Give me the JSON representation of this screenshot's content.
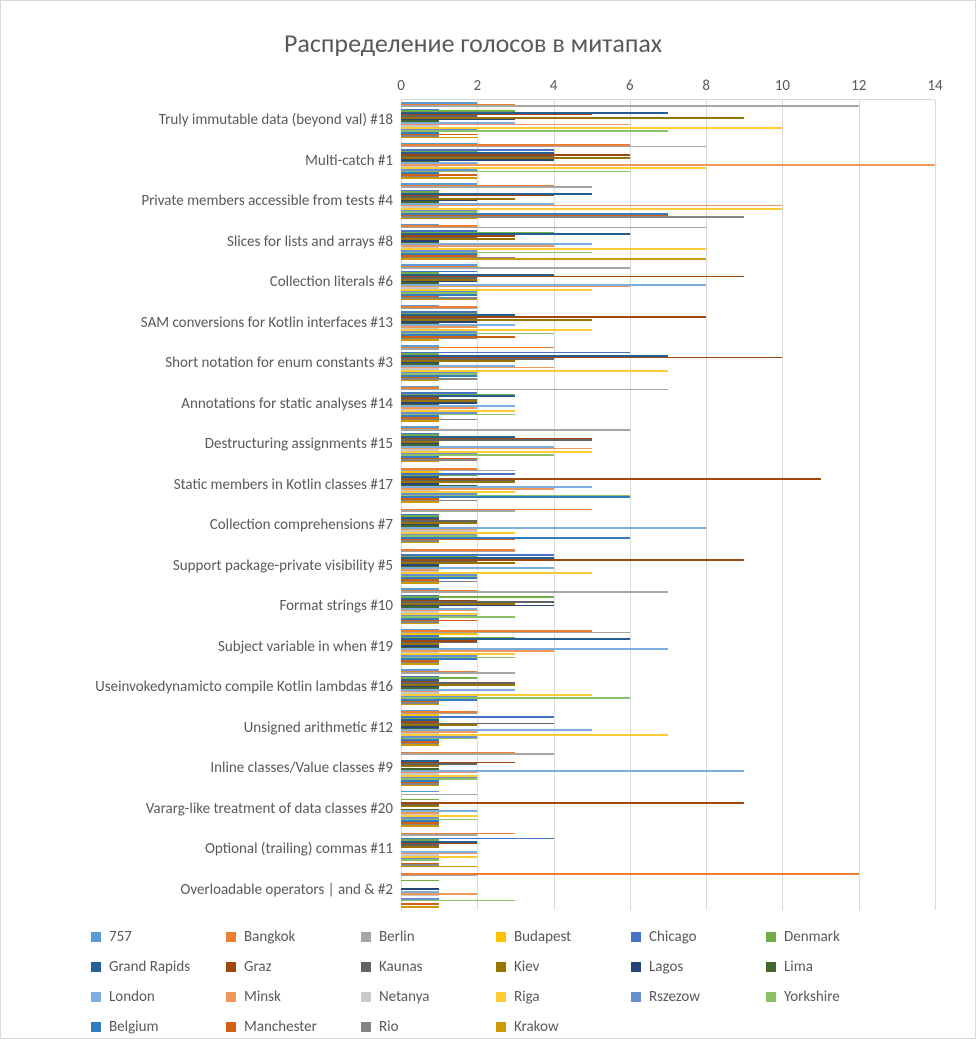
{
  "chart_data": {
    "type": "bar",
    "orientation": "horizontal",
    "title": "Распределение голосов в митапах",
    "xlabel": "",
    "ylabel": "",
    "xlim": [
      0,
      14
    ],
    "x_ticks": [
      0,
      2,
      4,
      6,
      8,
      10,
      12,
      14
    ],
    "categories": [
      "Truly immutable data (beyond val) #18",
      "Multi-catch #1",
      "Private members accessible from tests #4",
      "Slices for lists and arrays #8",
      "Collection literals #6",
      "SAM conversions for Kotlin interfaces #13",
      "Short notation for enum constants #3",
      "Annotations for static analyses #14",
      "Destructuring assignments #15",
      "Static members in Kotlin classes #17",
      "Collection comprehensions #7",
      "Support package-private visibility #5",
      "Format strings #10",
      "Subject variable in when #19",
      "Useinvokedynamicto compile Kotlin lambdas #16",
      "Unsigned arithmetic #12",
      "Inline classes/Value classes #9",
      "Vararg-like treatment of data classes #20",
      "Optional (trailing) commas #11",
      "Overloadable operators | and & #2"
    ],
    "series": [
      {
        "name": "757",
        "color": "#5B9BD5",
        "values": [
          2,
          2,
          2,
          1,
          2,
          1,
          1,
          1,
          1,
          0,
          0,
          0,
          1,
          1,
          1,
          1,
          0,
          1,
          0,
          0
        ]
      },
      {
        "name": "Bangkok",
        "color": "#ED7D31",
        "values": [
          3,
          6,
          4,
          2,
          2,
          2,
          4,
          1,
          1,
          2,
          5,
          3,
          2,
          5,
          2,
          2,
          3,
          0,
          3,
          12
        ]
      },
      {
        "name": "Berlin",
        "color": "#A5A5A5",
        "values": [
          12,
          8,
          5,
          8,
          6,
          2,
          1,
          7,
          6,
          3,
          3,
          3,
          7,
          6,
          3,
          2,
          4,
          2,
          2,
          2
        ]
      },
      {
        "name": "Budapest",
        "color": "#FFC000",
        "values": [
          0,
          0,
          0,
          0,
          0,
          0,
          0,
          0,
          0,
          1,
          0,
          0,
          0,
          2,
          0,
          1,
          0,
          0,
          0,
          0
        ]
      },
      {
        "name": "Chicago",
        "color": "#4472C4",
        "values": [
          1,
          4,
          1,
          2,
          2,
          2,
          6,
          2,
          1,
          3,
          1,
          4,
          1,
          1,
          1,
          4,
          0,
          0,
          4,
          0
        ]
      },
      {
        "name": "Denmark",
        "color": "#70AD47",
        "values": [
          3,
          2,
          1,
          4,
          1,
          2,
          1,
          3,
          1,
          2,
          1,
          2,
          4,
          3,
          2,
          1,
          0,
          1,
          1,
          1
        ]
      },
      {
        "name": "Grand Rapids",
        "color": "#255E91",
        "values": [
          7,
          4,
          5,
          6,
          4,
          3,
          7,
          3,
          3,
          1,
          1,
          4,
          1,
          6,
          1,
          1,
          1,
          0,
          2,
          0
        ]
      },
      {
        "name": "Graz",
        "color": "#9E480E",
        "values": [
          5,
          6,
          4,
          3,
          9,
          8,
          10,
          1,
          5,
          11,
          1,
          9,
          2,
          2,
          1,
          1,
          3,
          9,
          2,
          0
        ]
      },
      {
        "name": "Kaunas",
        "color": "#636363",
        "values": [
          2,
          4,
          1,
          2,
          2,
          2,
          4,
          2,
          5,
          3,
          2,
          2,
          4,
          2,
          3,
          4,
          2,
          1,
          1,
          0
        ]
      },
      {
        "name": "Kiev",
        "color": "#997300",
        "values": [
          9,
          6,
          3,
          3,
          2,
          5,
          3,
          2,
          1,
          3,
          2,
          3,
          3,
          1,
          3,
          2,
          1,
          1,
          1,
          0
        ]
      },
      {
        "name": "Lagos",
        "color": "#264478",
        "values": [
          3,
          4,
          2,
          1,
          2,
          2,
          1,
          2,
          1,
          1,
          1,
          1,
          4,
          1,
          1,
          1,
          0,
          0,
          0,
          1
        ]
      },
      {
        "name": "Lima",
        "color": "#43682B",
        "values": [
          1,
          1,
          1,
          1,
          1,
          1,
          1,
          1,
          1,
          2,
          1,
          1,
          1,
          1,
          1,
          1,
          1,
          1,
          0,
          0
        ]
      },
      {
        "name": "London",
        "color": "#7CAFDD",
        "values": [
          3,
          2,
          4,
          5,
          8,
          3,
          3,
          3,
          4,
          5,
          8,
          4,
          2,
          7,
          3,
          5,
          9,
          2,
          2,
          1
        ]
      },
      {
        "name": "Minsk",
        "color": "#F1975A",
        "values": [
          6,
          14,
          10,
          4,
          6,
          2,
          4,
          2,
          5,
          4,
          2,
          1,
          2,
          4,
          1,
          2,
          2,
          1,
          2,
          2
        ]
      },
      {
        "name": "Netanya",
        "color": "#C9C9C9",
        "values": [
          1,
          1,
          1,
          1,
          1,
          1,
          1,
          1,
          1,
          1,
          2,
          1,
          1,
          1,
          1,
          1,
          1,
          1,
          1,
          1
        ]
      },
      {
        "name": "Riga",
        "color": "#FFCD33",
        "values": [
          10,
          8,
          10,
          8,
          5,
          5,
          7,
          3,
          5,
          3,
          3,
          5,
          2,
          3,
          5,
          7,
          2,
          2,
          2,
          0
        ]
      },
      {
        "name": "Rszezow",
        "color": "#698ED0",
        "values": [
          2,
          2,
          2,
          2,
          2,
          2,
          2,
          2,
          2,
          2,
          2,
          2,
          2,
          2,
          2,
          2,
          2,
          1,
          1,
          1
        ]
      },
      {
        "name": "Yorkshire",
        "color": "#8CC168",
        "values": [
          7,
          6,
          2,
          5,
          2,
          4,
          2,
          3,
          4,
          6,
          2,
          2,
          3,
          3,
          6,
          2,
          2,
          2,
          1,
          3
        ]
      },
      {
        "name": "Belgium",
        "color": "#327DC2",
        "values": [
          1,
          1,
          7,
          2,
          2,
          2,
          2,
          1,
          1,
          6,
          6,
          2,
          1,
          2,
          2,
          1,
          1,
          1,
          0,
          0
        ]
      },
      {
        "name": "Manchester",
        "color": "#D26012",
        "values": [
          2,
          2,
          7,
          2,
          1,
          3,
          1,
          1,
          2,
          1,
          3,
          1,
          2,
          1,
          1,
          1,
          1,
          1,
          1,
          1
        ]
      },
      {
        "name": "Rio",
        "color": "#848484",
        "values": [
          1,
          1,
          9,
          3,
          2,
          2,
          2,
          2,
          2,
          2,
          1,
          2,
          1,
          1,
          1,
          1,
          1,
          1,
          1,
          0
        ]
      },
      {
        "name": "Krakow",
        "color": "#CC9A00",
        "values": [
          2,
          2,
          2,
          8,
          2,
          1,
          1,
          1,
          1,
          1,
          1,
          1,
          1,
          1,
          1,
          1,
          1,
          1,
          2,
          1
        ]
      }
    ]
  }
}
